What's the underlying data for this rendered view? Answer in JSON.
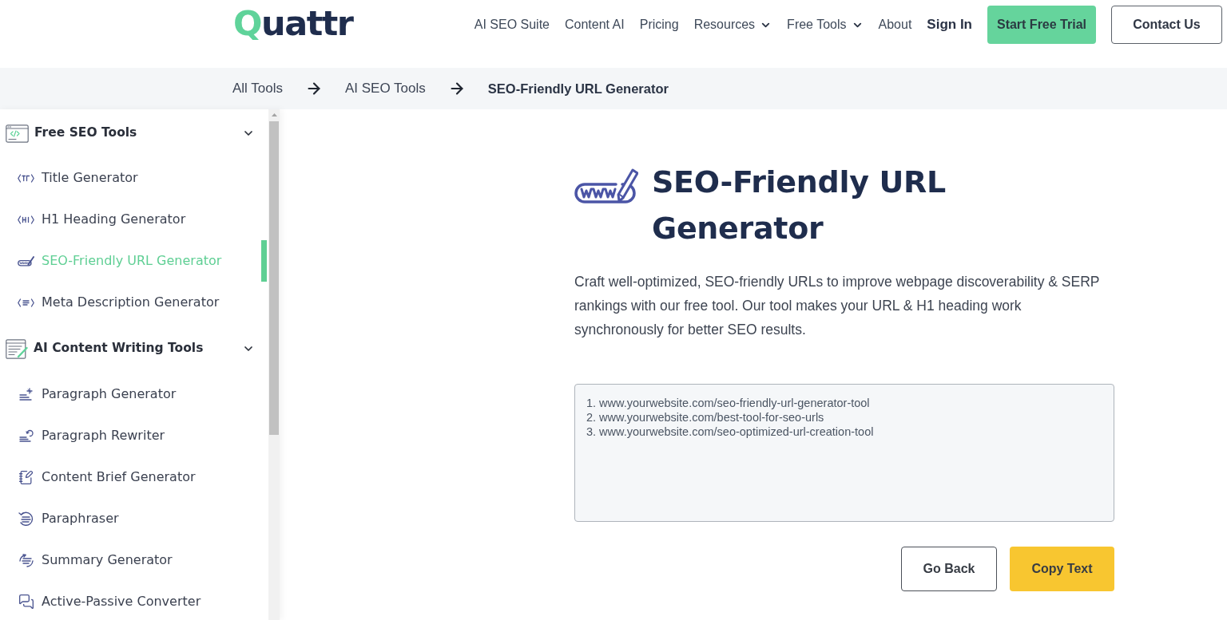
{
  "header": {
    "logo": "Quattr",
    "nav": [
      {
        "label": "AI SEO Suite",
        "dropdown": false
      },
      {
        "label": "Content AI",
        "dropdown": false
      },
      {
        "label": "Pricing",
        "dropdown": false
      },
      {
        "label": "Resources",
        "dropdown": true
      },
      {
        "label": "Free Tools",
        "dropdown": true
      },
      {
        "label": "About",
        "dropdown": false
      }
    ],
    "sign_in": "Sign In",
    "buttons": [
      {
        "label": "Start Free Trial",
        "kind": "primary"
      },
      {
        "label": "Contact Us",
        "kind": "outline"
      }
    ]
  },
  "breadcrumb": [
    {
      "label": "All Tools",
      "current": false
    },
    {
      "label": "AI SEO Tools",
      "current": false
    },
    {
      "label": "SEO-Friendly URL Generator",
      "current": true
    }
  ],
  "sidebar": {
    "groups": [
      {
        "title": "Free SEO Tools",
        "expanded": true,
        "items": [
          {
            "label": "Title Generator",
            "selected": false
          },
          {
            "label": "H1 Heading Generator",
            "selected": false
          },
          {
            "label": "SEO-Friendly URL Generator",
            "selected": true
          },
          {
            "label": "Meta Description Generator",
            "selected": false
          }
        ]
      },
      {
        "title": "AI Content Writing Tools",
        "expanded": true,
        "items": [
          {
            "label": "Paragraph Generator",
            "selected": false
          },
          {
            "label": "Paragraph Rewriter",
            "selected": false
          },
          {
            "label": "Content Brief Generator",
            "selected": false
          },
          {
            "label": "Paraphraser",
            "selected": false
          },
          {
            "label": "Summary Generator",
            "selected": false
          },
          {
            "label": "Active-Passive Converter",
            "selected": false
          }
        ]
      }
    ]
  },
  "tool": {
    "title": "SEO-Friendly URL Generator",
    "description": "Craft well-optimized, SEO-friendly URLs to improve webpage discoverability & SERP rankings with our free tool. Our tool makes your URL & H1 heading work synchronously for better SEO results.",
    "output": {
      "lines": [
        "1. www.yourwebsite.com/seo-friendly-url-generator-tool",
        "2. www.yourwebsite.com/best-tool-for-seo-urls",
        "3. www.yourwebsite.com/seo-optimized-url-creation-tool"
      ]
    },
    "buttons": [
      {
        "label": "Go Back",
        "kind": "outline"
      },
      {
        "label": "Copy Text",
        "kind": "primary"
      }
    ]
  }
}
